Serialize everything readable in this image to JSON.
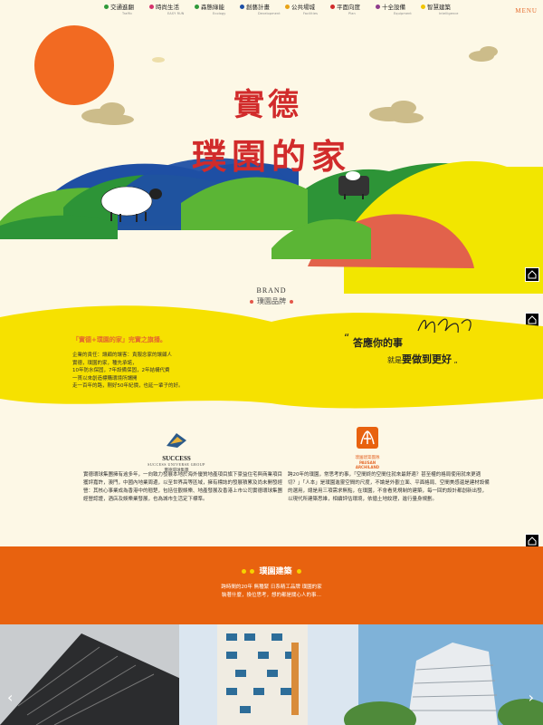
{
  "nav": {
    "items": [
      {
        "label": "交通進翻",
        "sub": "Traffic",
        "color": "#2f9a3a"
      },
      {
        "label": "時尚生活",
        "sub": "EASY RUN",
        "color": "#d6336c"
      },
      {
        "label": "森態綠能",
        "sub": "Ecology",
        "color": "#2f9a3a"
      },
      {
        "label": "創藝計畫",
        "sub": "Development",
        "color": "#1c4fa6"
      },
      {
        "label": "公共場城",
        "sub": "Facilities",
        "color": "#e8a317"
      },
      {
        "label": "平面向度",
        "sub": "Plan",
        "color": "#d12b2b"
      },
      {
        "label": "十全設備",
        "sub": "Equipment",
        "color": "#8e3b8c"
      },
      {
        "label": "智慧建築",
        "sub": "Intelligence",
        "color": "#f2c500"
      }
    ],
    "menu_label": "MENU"
  },
  "hero": {
    "title_line1": "實德",
    "title_line2": "璞園的家"
  },
  "brand": {
    "heading_en": "BRAND",
    "heading_zh": "璞園品牌",
    "slogan_title": "「實德+璞園的家」完實之旗播。",
    "slogan_body": [
      "企業的責任：讓顧的讓客：責服念家的讓顧人",
      "實德，璞園的家，種先承諾，",
      "10年防水保固，7年設備保固，2年結構代費",
      "一貫以來創造標購環境所謂開",
      "走一百年的路，剛好50年紀價，也延一輩子的好。"
    ],
    "motto_line1": "答應你的事",
    "motto_line2_pre": "就是",
    "motto_line2_bold": "要做到更好",
    "signature": "signature"
  },
  "group": {
    "success": {
      "name": "SUCCESS",
      "en": "SUCCESS UNIVERSE GROUP",
      "zh": "實德環球集團"
    },
    "pausan": {
      "zh": "璞園建築團隊",
      "en1": "PAUSAN",
      "en2": "ARCHILAND"
    },
    "left_text": "實德環球集團擁有逾多年，一向致力發展本地於海外優質地產項目旗下豪益住宅與商業項目獲評嘉許，澳門，中國內地業周邊，以至世界高等區域，擁有標誌的發展積累及尚未開發經營：其核心事業成為香港中的翹楚，包括住觀娛樂、地產發展及香港上市公司實德環球集團經營認證，酒店及娛樂業發展，也為城市生活定下標準。",
    "right_text": "跨20年的璞園，常思考的事，「空間終的空間住就來最舒適？甚至權的格局使用就來更適切？」「人本」是璞園進靈空間的尺度，不論是外觀立面、平面格局、空間美感還是建材設備的選用，總是用三項需求無點，在璞園，不會看見規制的建築，每一回的設計都創新出發，以現代所建築思維，相續評估環境，依循土地紋理，進行量身規劃。"
  },
  "architecture": {
    "title": "璞園建築",
    "text": [
      "跨時間的20年 無種緊 日系精工品牌 璞園的家",
      "裝著什麼，換位思考，想的都是關心人的事…"
    ]
  },
  "colors": {
    "bg": "#fdf8e6",
    "accent_orange": "#e8620f",
    "title_red": "#d12b2b",
    "sun": "#f26a22",
    "yellow": "#f6e100"
  }
}
